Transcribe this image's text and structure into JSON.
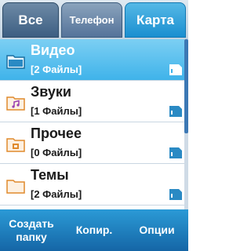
{
  "tabs": {
    "all": "Все",
    "phone": "Телефон",
    "card": "Карта",
    "active": "card"
  },
  "folders": [
    {
      "name": "Видео",
      "count": "[2 Файлы]",
      "selected": true,
      "icon": "video-folder-icon"
    },
    {
      "name": "Звуки",
      "count": "[1 Файлы]",
      "selected": false,
      "icon": "music-folder-icon"
    },
    {
      "name": "Прочее",
      "count": "[0 Файлы]",
      "selected": false,
      "icon": "other-folder-icon"
    },
    {
      "name": "Темы",
      "count": "[2 Файлы]",
      "selected": false,
      "icon": "folder-icon"
    }
  ],
  "softkeys": {
    "left": "Создать\nпапку",
    "middle": "Копир.",
    "right": "Опции"
  },
  "colors": {
    "accent": "#3fb3ea",
    "softkey_bar": "#1e80c0",
    "folder": "#f0a040"
  }
}
